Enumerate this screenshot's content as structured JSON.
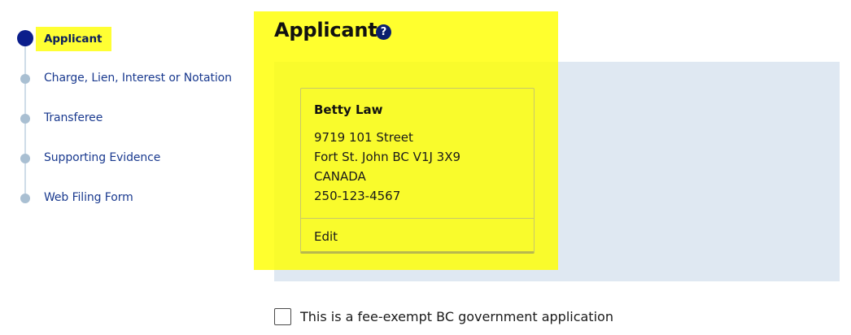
{
  "stepper": {
    "steps": [
      {
        "label": "Applicant",
        "active": true
      },
      {
        "label": "Charge, Lien, Interest or Notation",
        "active": false
      },
      {
        "label": "Transferee",
        "active": false
      },
      {
        "label": "Supporting Evidence",
        "active": false
      },
      {
        "label": "Web Filing Form",
        "active": false
      }
    ]
  },
  "section": {
    "title": "Applicant",
    "help_icon": "question-circle-icon",
    "help_glyph": "?"
  },
  "applicant_card": {
    "name": "Betty Law",
    "address_line1": "9719 101 Street",
    "address_line2": "Fort St. John BC V1J 3X9",
    "country": "CANADA",
    "phone": "250-123-4567",
    "edit_label": "Edit"
  },
  "fee_exempt": {
    "label": "This is a fee-exempt BC government application",
    "checked": false
  },
  "colors": {
    "highlight": "#ffff33",
    "active_step": "#0b1e8c",
    "inactive_step": "#a9bfd2",
    "step_text": "#1a3a8f",
    "panel_background": "#dfe8f2"
  }
}
